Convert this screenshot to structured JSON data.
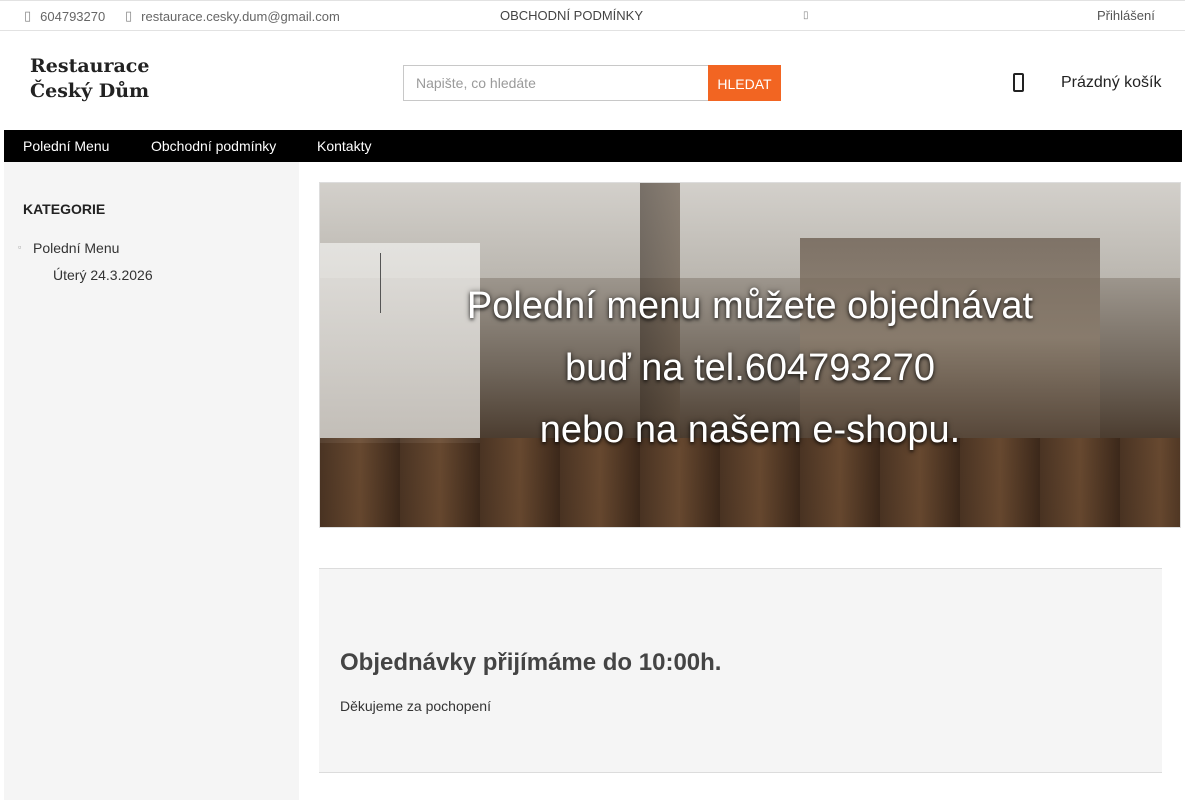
{
  "topbar": {
    "phone": "604793270",
    "email": "restaurace.cesky.dum@gmail.com",
    "terms": "OBCHODNÍ PODMÍNKY",
    "login": "Přihlášení"
  },
  "header": {
    "logo_line1": "Restaurace",
    "logo_line2": "Český Dům",
    "search_placeholder": "Napište, co hledáte",
    "search_button": "HLEDAT",
    "cart_label": "Prázdný košík"
  },
  "nav": {
    "items": [
      {
        "label": "Polední Menu"
      },
      {
        "label": "Obchodní podmínky"
      },
      {
        "label": "Kontakty"
      }
    ]
  },
  "sidebar": {
    "heading": "KATEGORIE",
    "category": "Polední Menu",
    "subcategory": "Úterý 24.3.2026"
  },
  "banner": {
    "line1": "Polední menu můžete objednávat",
    "line2": "buď na tel.604793270",
    "line3": "nebo na našem e-shopu."
  },
  "notice": {
    "title": "Objednávky přijímáme do 10:00h.",
    "text": "Děkujeme za pochopení"
  }
}
